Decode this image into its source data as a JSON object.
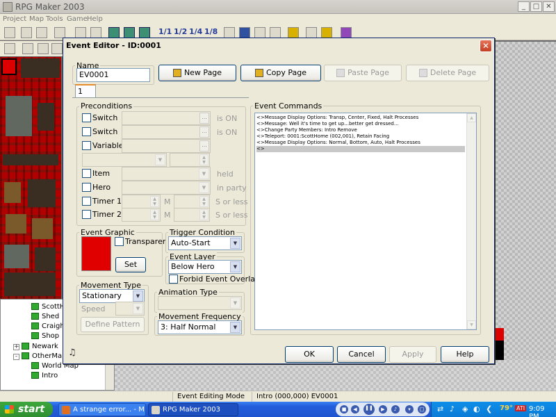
{
  "app": {
    "title": "RPG Maker 2003",
    "menu": [
      "Project",
      "Map",
      "Tools",
      "Game",
      "Help"
    ],
    "toolbar_text": [
      "1/1",
      "1/2",
      "1/4",
      "1/8"
    ]
  },
  "dialog": {
    "title": "Event Editor - ID:0001",
    "close": "✕",
    "name_label": "Name",
    "name_value": "EV0001",
    "buttons": {
      "new_page": "New Page",
      "copy_page": "Copy Page",
      "paste_page": "Paste Page",
      "delete_page": "Delete Page"
    },
    "tab": "1",
    "preconditions": {
      "label": "Preconditions",
      "switch1": "Switch",
      "switch2": "Switch",
      "is_on1": "is ON",
      "is_on2": "is ON",
      "variable": "Variable",
      "item": "Item",
      "held": "held",
      "hero": "Hero",
      "in_party": "in party",
      "timer1": "Timer 1",
      "timer2": "Timer 2",
      "m1": "M",
      "m2": "M",
      "s_or_less1": "S or less",
      "s_or_less2": "S or less"
    },
    "event_graphic": {
      "label": "Event Graphic",
      "transparent": "Transparer",
      "set": "Set"
    },
    "trigger": {
      "label": "Trigger Condition",
      "value": "Auto-Start"
    },
    "event_layer": {
      "label": "Event Layer",
      "value": "Below Hero",
      "forbid": "Forbid Event Overlap"
    },
    "movement_type": {
      "label": "Movement Type",
      "value": "Stationary",
      "speed": "Speed",
      "define_pattern": "Define Pattern"
    },
    "animation_type": {
      "label": "Animation Type"
    },
    "movement_frequency": {
      "label": "Movement Frequency",
      "value": "3: Half Normal"
    },
    "event_commands": {
      "label": "Event Commands",
      "items": [
        "<>Message Display Options: Transp, Center, Fixed, Halt Processes",
        "<>Message: Well it's time to get up...better get dressed...",
        "<>Change Party Members: Intro Remove",
        "<>Teleport: 0001:ScottHome (002,001), Retain Facing",
        "<>Message Display Options: Normal, Bottom, Auto, Halt Processes",
        "<>"
      ]
    },
    "footer": {
      "ok": "OK",
      "cancel": "Cancel",
      "apply": "Apply",
      "help": "Help"
    }
  },
  "tree": {
    "items": [
      "ScottH",
      "Shed",
      "Craigh",
      "Shop",
      "Newark",
      "OtherMap",
      "World Map",
      "Intro"
    ]
  },
  "status": {
    "mode": "Event Editing Mode",
    "location": "Intro (000,000) EV0001"
  },
  "taskbar": {
    "start": "start",
    "items": [
      "A strange error... - M...",
      "RPG Maker 2003"
    ],
    "temp": "79°",
    "clock": "9:09 PM"
  }
}
